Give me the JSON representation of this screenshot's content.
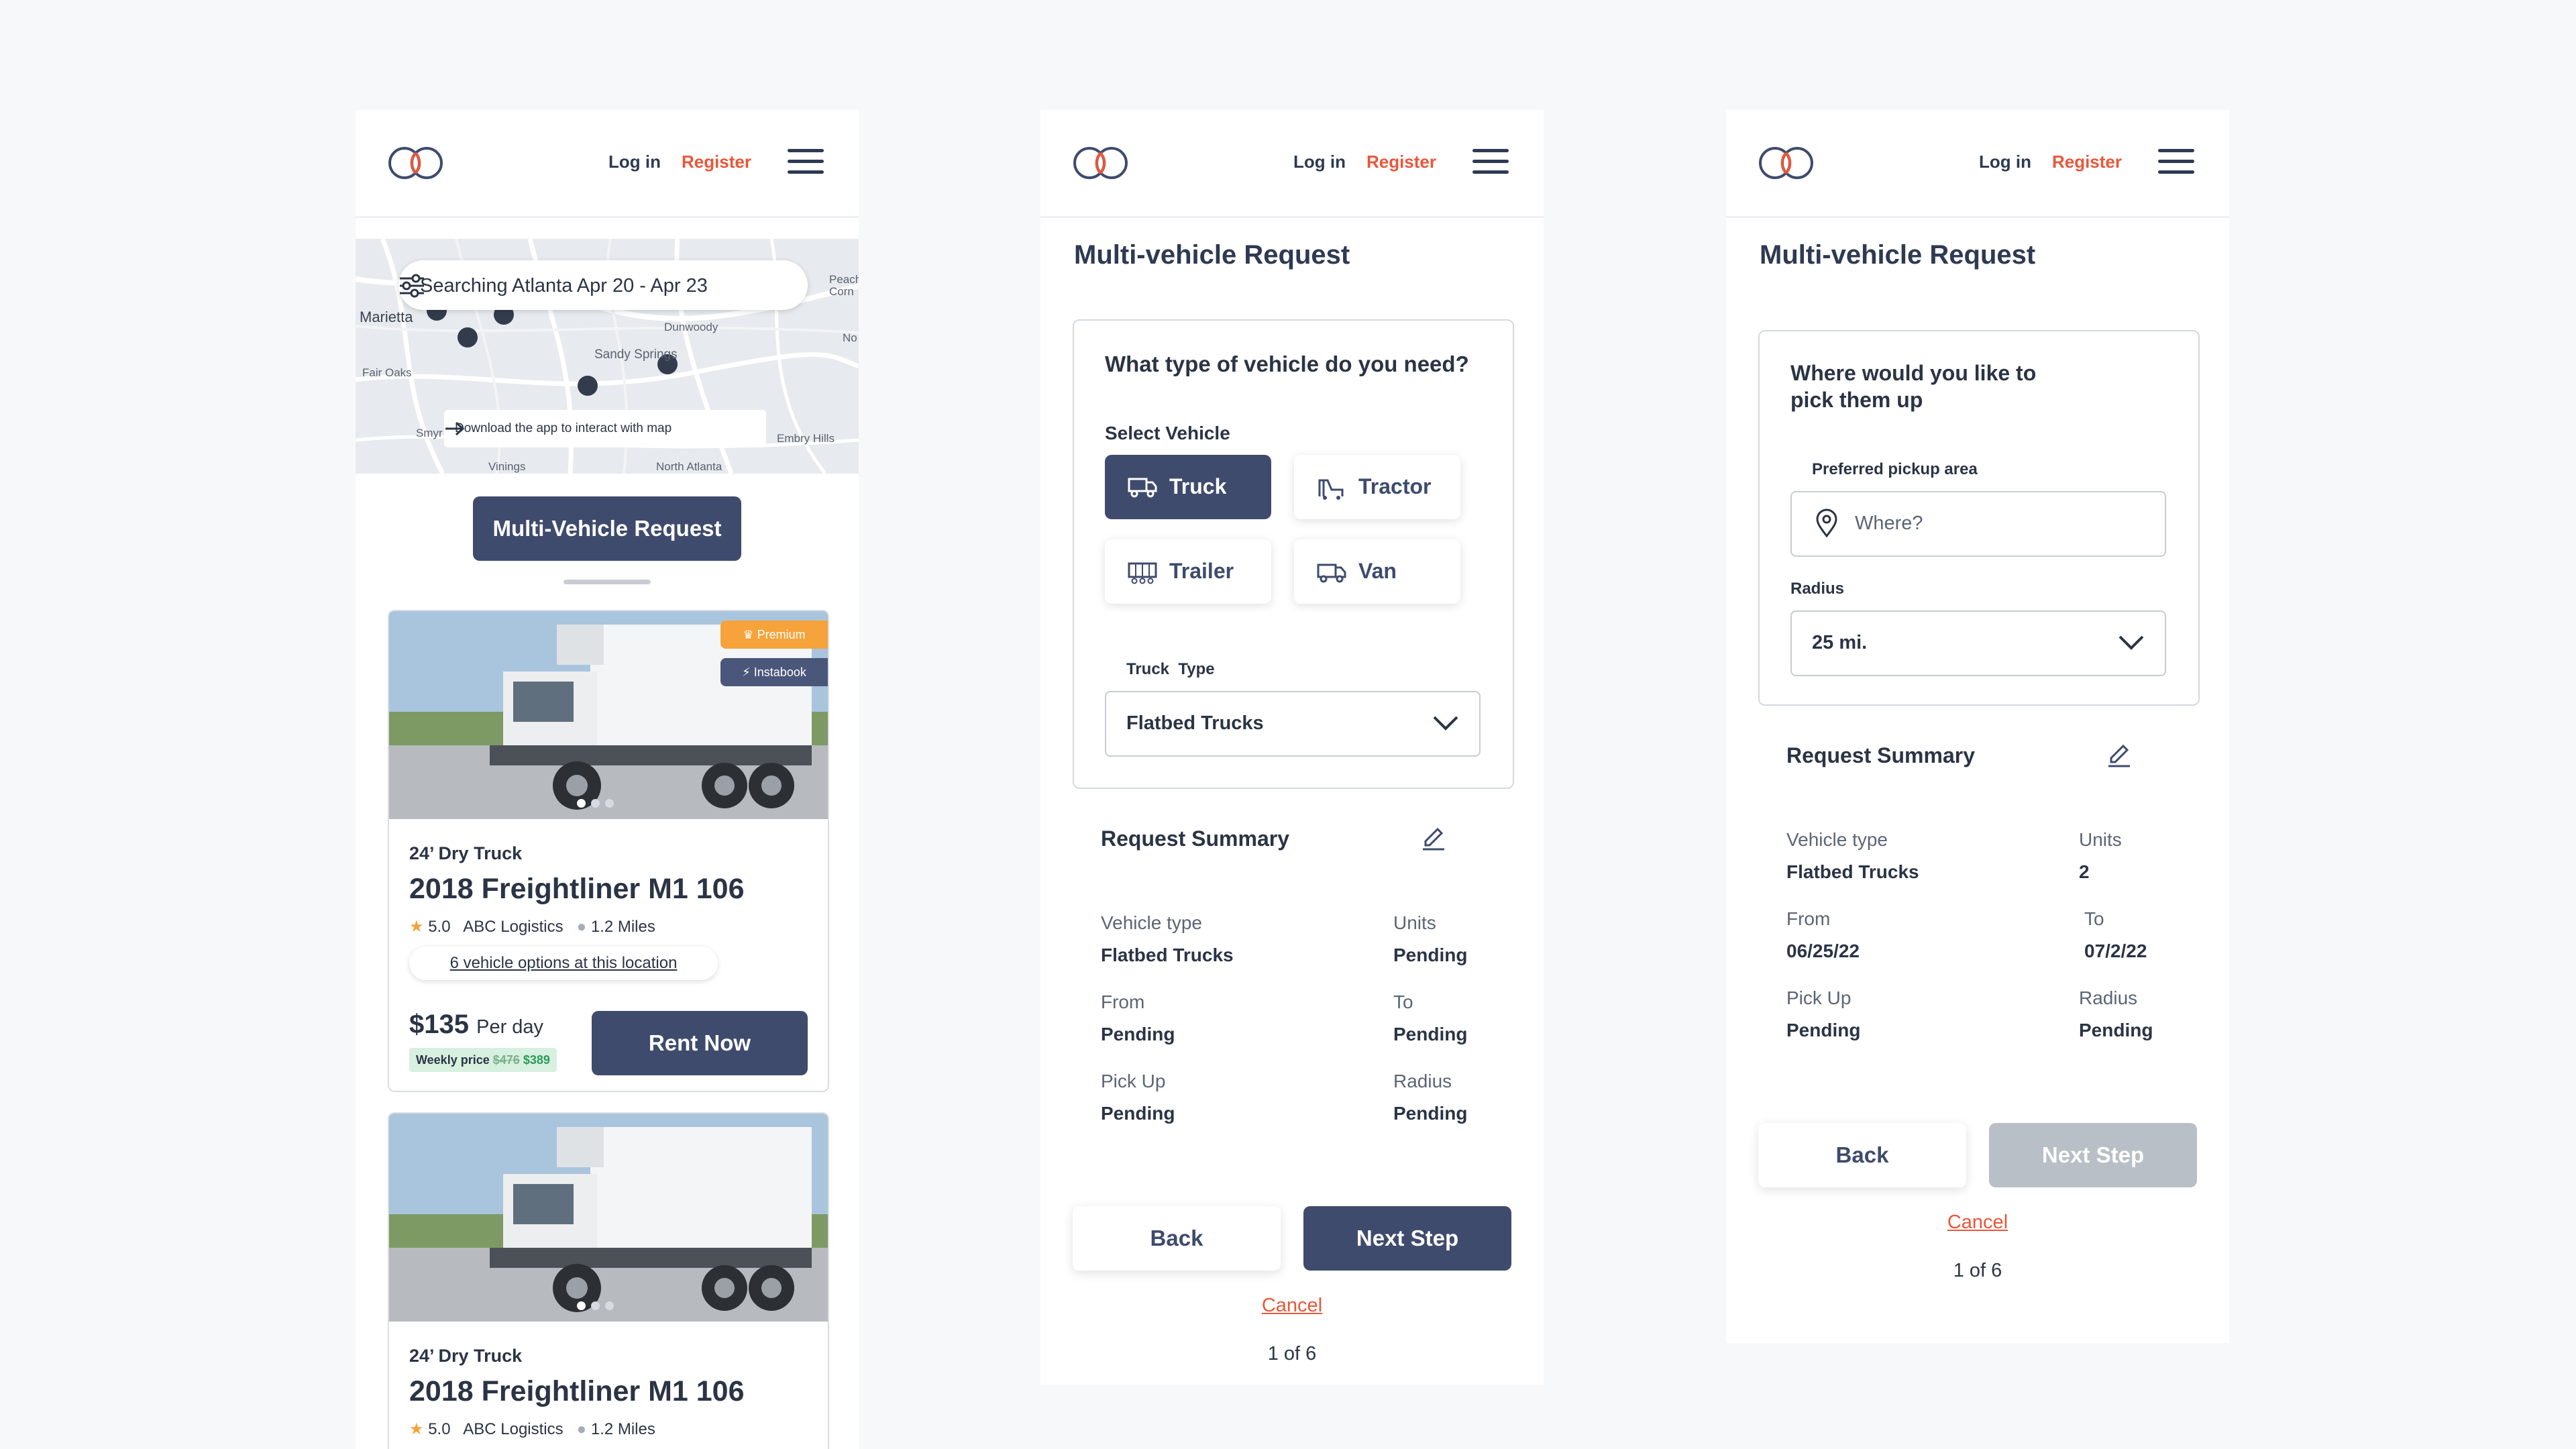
{
  "nav": {
    "login": "Log in",
    "register": "Register"
  },
  "colors": {
    "primary": "#3f4b6d",
    "accent": "#e8573a",
    "premium": "#f5a33a",
    "disabled": "#b9bfc7"
  },
  "search_screen": {
    "search_text": "Searching Atlanta Apr 20 - Apr 23",
    "map_towns": [
      "Marietta",
      "Dunwoody",
      "Sandy Springs",
      "Fair Oaks",
      "Smyr",
      "Vinings",
      "North Atlanta",
      "Embry Hills",
      "Peach Corn",
      "No"
    ],
    "download_hint": "Download the app to interact with map",
    "multi_vehicle_button": "Multi-Vehicle Request",
    "listings": [
      {
        "badge_premium": "Premium",
        "badge_instabook": "Instabook",
        "subtitle": "24’ Dry Truck",
        "title": "2018 Freightliner M1 106",
        "rating": "5.0",
        "company": "ABC Logistics",
        "distance": "1.2 Miles",
        "options_link": "6 vehicle options at this location",
        "price": "$135",
        "price_unit": "Per day",
        "weekly_label": "Weekly price",
        "weekly_old": "$476",
        "weekly_new": "$389",
        "rent_button": "Rent Now"
      },
      {
        "subtitle": "24’ Dry Truck",
        "title": "2018 Freightliner M1 106",
        "rating": "5.0",
        "company": "ABC Logistics",
        "distance": "1.2 Miles"
      }
    ]
  },
  "vehicle_step": {
    "page_title": "Multi-vehicle Request",
    "question": "What type of vehicle do you need?",
    "select_label": "Select Vehicle",
    "vehicle_options": [
      {
        "label": "Truck",
        "icon": "truck-icon",
        "selected": true
      },
      {
        "label": "Tractor",
        "icon": "tractor-icon",
        "selected": false
      },
      {
        "label": "Trailer",
        "icon": "trailer-icon",
        "selected": false
      },
      {
        "label": "Van",
        "icon": "van-icon",
        "selected": false
      }
    ],
    "truck_type_label": "Truck  Type",
    "truck_type_value": "Flatbed Trucks",
    "summary": {
      "title": "Request Summary",
      "vehicle_type_label": "Vehicle type",
      "vehicle_type_value": "Flatbed Trucks",
      "units_label": "Units",
      "units_value": "Pending",
      "from_label": "From",
      "from_value": "Pending",
      "to_label": "To",
      "to_value": "Pending",
      "pickup_label": "Pick Up",
      "pickup_value": "Pending",
      "radius_label": "Radius",
      "radius_value": "Pending"
    },
    "back_button": "Back",
    "next_button": "Next Step",
    "cancel": "Cancel",
    "progress": "1 of 6"
  },
  "pickup_step": {
    "page_title": "Multi-vehicle Request",
    "question": "Where would you like to pick them up",
    "area_label": "Preferred pickup area",
    "area_placeholder": "Where?",
    "radius_label": "Radius",
    "radius_value": "25 mi.",
    "summary": {
      "title": "Request Summary",
      "vehicle_type_label": "Vehicle type",
      "vehicle_type_value": "Flatbed Trucks",
      "units_label": "Units",
      "units_value": "2",
      "from_label": "From",
      "from_value": "06/25/22",
      "to_label": "To",
      "to_value": "07/2/22",
      "pickup_label": "Pick Up",
      "pickup_value": "Pending",
      "radius_label": "Radius",
      "radius_value": "Pending"
    },
    "back_button": "Back",
    "next_button": "Next Step",
    "cancel": "Cancel",
    "progress": "1 of 6"
  }
}
